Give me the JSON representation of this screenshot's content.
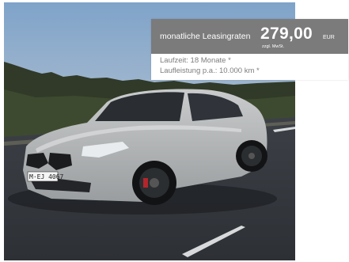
{
  "photo": {
    "plate": "M·EJ 4067"
  },
  "lease": {
    "label": "monatliche Leasingraten",
    "price": "279,00",
    "currency": "EUR",
    "tax_note": "zzgl. MwSt.",
    "duration": "Laufzeit: 18 Monate *",
    "mileage": "Laufleistung p.a.: 10.000 km *"
  },
  "colors": {
    "header_bg": "#7b7b7b",
    "secondary_text": "#7d7d7d"
  }
}
